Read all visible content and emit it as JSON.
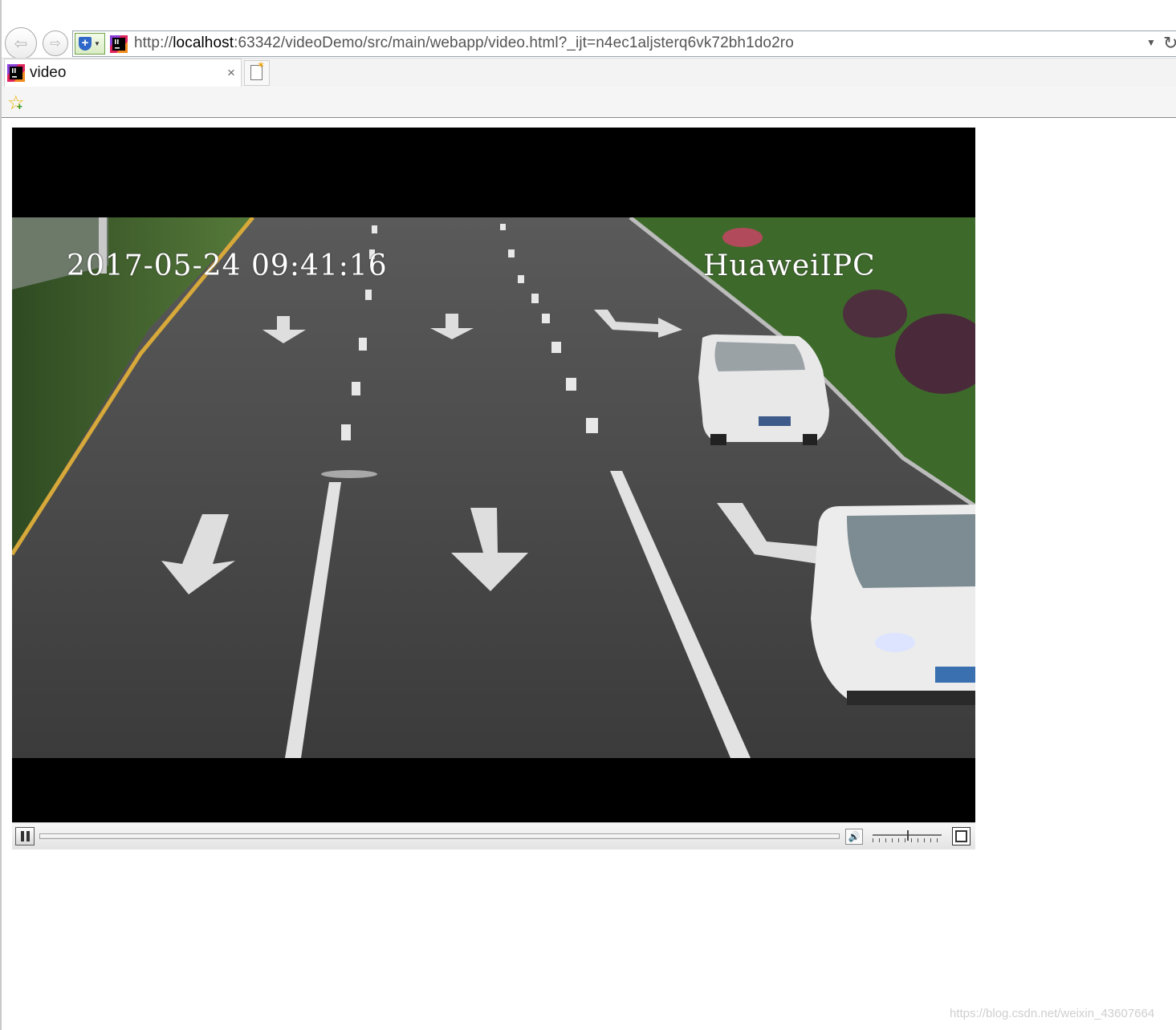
{
  "browser": {
    "url_scheme": "http://",
    "url_host": "localhost",
    "url_rest": ":63342/videoDemo/src/main/webapp/video.html?_ijt=n4ec1aljsterq6vk72bh1do2ro",
    "tab_title": "video",
    "tab_close_glyph": "×",
    "icons": [
      "back-arrow-icon",
      "forward-arrow-icon",
      "compatibility-view-icon",
      "intellij-site-icon",
      "address-dropdown-icon",
      "refresh-icon",
      "new-tab-icon",
      "favorites-star-icon"
    ]
  },
  "video": {
    "overlay_timestamp": "2017-05-24 09:41:16",
    "overlay_camera": "HuaweiIPC",
    "state": "playing",
    "seek_progress": 0.0,
    "volume_level": 0.5
  },
  "watermark": "https://blog.csdn.net/weixin_43607664",
  "colors": {
    "video_bg": "#000000",
    "road": "#4a4a4a",
    "grass": "#3f6e2c",
    "controls_bg": "#ececec"
  }
}
